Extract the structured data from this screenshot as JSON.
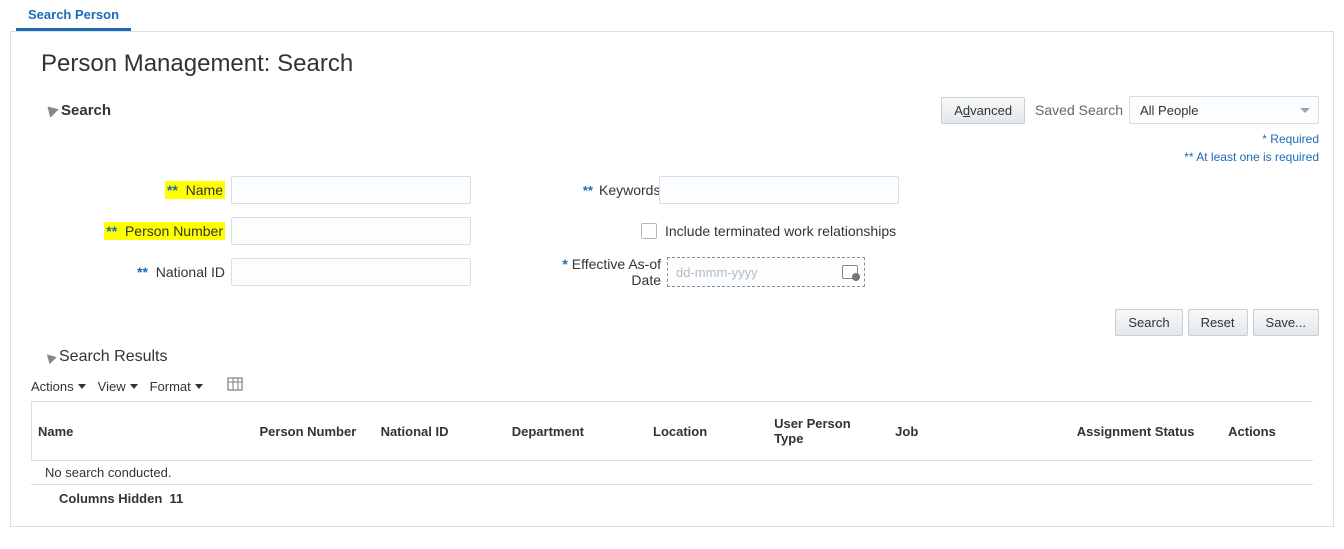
{
  "tab": {
    "active_label": "Search Person"
  },
  "page": {
    "title": "Person Management: Search"
  },
  "search_section": {
    "title": "Search",
    "advanced_btn_pre": "A",
    "advanced_btn_key": "d",
    "advanced_btn_post": "vanced",
    "saved_search_label": "Saved Search",
    "saved_search_value": "All People",
    "hint_required": "*  Required",
    "hint_at_least_one": "** At least one is required"
  },
  "fields": {
    "name_prefix": "**",
    "name_label": "Name",
    "person_number_prefix": "**",
    "person_number_label": "Person Number",
    "national_id_prefix": "**",
    "national_id_label": "National ID",
    "keywords_prefix": "**",
    "keywords_label": "Keywords",
    "include_terminated_label": "Include terminated work relationships",
    "effective_date_prefix": "*",
    "effective_date_label": "Effective As-of Date",
    "effective_date_placeholder": "dd-mmm-yyyy"
  },
  "buttons": {
    "search": "Search",
    "reset": "Reset",
    "save": "Save..."
  },
  "results": {
    "title": "Search Results",
    "menu_actions": "Actions",
    "menu_view": "View",
    "menu_format": "Format",
    "columns": {
      "name": "Name",
      "person_number": "Person Number",
      "national_id": "National ID",
      "department": "Department",
      "location": "Location",
      "user_person_type": "User Person Type",
      "job": "Job",
      "assignment_status": "Assignment Status",
      "actions": "Actions"
    },
    "no_data": "No search conducted.",
    "columns_hidden_label": "Columns Hidden",
    "columns_hidden_count": "11"
  }
}
